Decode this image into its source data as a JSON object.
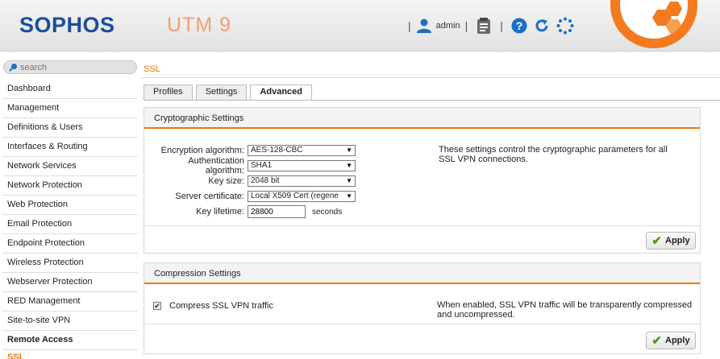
{
  "header": {
    "logo": "SOPHOS",
    "product": "UTM 9",
    "user": "admin",
    "colors": {
      "brand": "#1a4e9c",
      "accent": "#f47a20"
    },
    "icons": [
      "user-icon",
      "clipboard-icon",
      "help-icon",
      "refresh-icon",
      "activity-icon"
    ]
  },
  "search": {
    "placeholder": "search"
  },
  "sidebar": {
    "items": [
      "Dashboard",
      "Management",
      "Definitions & Users",
      "Interfaces & Routing",
      "Network Services",
      "Network Protection",
      "Web Protection",
      "Email Protection",
      "Endpoint Protection",
      "Wireless Protection",
      "Webserver Protection",
      "RED Management",
      "Site-to-site VPN",
      "Remote Access"
    ],
    "subitem": "SSL"
  },
  "breadcrumb": "SSL",
  "tabs": [
    "Profiles",
    "Settings",
    "Advanced"
  ],
  "crypto": {
    "title": "Cryptographic Settings",
    "encryption_label": "Encryption algorithm:",
    "encryption_value": "AES-128-CBC",
    "auth_label": "Authentication algorithm:",
    "auth_value": "SHA1",
    "keysize_label": "Key size:",
    "keysize_value": "2048 bit",
    "cert_label": "Server certificate:",
    "cert_value": "Local X509 Cert (regene",
    "lifetime_label": "Key lifetime:",
    "lifetime_value": "28800",
    "lifetime_unit": "seconds",
    "help": "These settings control the cryptographic parameters for all SSL VPN connections.",
    "apply": "Apply"
  },
  "compression": {
    "title": "Compression Settings",
    "checkbox_label": "Compress SSL VPN traffic",
    "checked": true,
    "help": "When enabled, SSL VPN traffic will be transparently compressed and uncompressed.",
    "apply": "Apply"
  }
}
